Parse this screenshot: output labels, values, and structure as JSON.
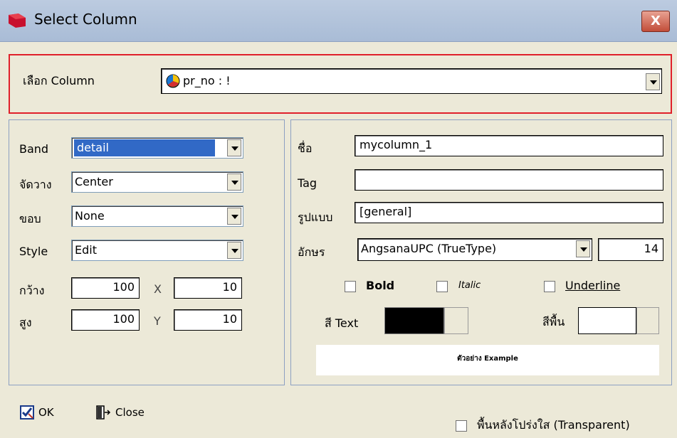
{
  "window": {
    "title": "Select Column",
    "close_label": "X"
  },
  "select_column": {
    "label": "เลือก Column",
    "value": "pr_no : !"
  },
  "left": {
    "band_label": "Band",
    "band_value": "detail",
    "align_label": "จัดวาง",
    "align_value": "Center",
    "border_label": "ขอบ",
    "border_value": "None",
    "style_label": "Style",
    "style_value": "Edit",
    "width_label": "กว้าง",
    "width_value": "100",
    "x_label": "X",
    "x_value": "10",
    "height_label": "สูง",
    "height_value": "100",
    "y_label": "Y",
    "y_value": "10"
  },
  "right": {
    "name_label": "ชื่อ",
    "name_value": "mycolumn_1",
    "tag_label": "Tag",
    "tag_value": "",
    "format_label": "รูปแบบ",
    "format_value": "[general]",
    "font_label": "อักษร",
    "font_value": "AngsanaUPC (TrueType)",
    "font_size": "14",
    "bold_label": "Bold",
    "italic_label": "Italic",
    "underline_label": "Underline",
    "text_color_label": "สี Text",
    "bg_color_label": "สีพื้น",
    "preview_text": "ตัวอย่าง Example"
  },
  "footer": {
    "ok_label": "OK",
    "close_label": "Close",
    "transparent_label": "พื้นหลังโปร่งใส (Transparent)"
  },
  "colors": {
    "text_color": "#000000",
    "bg_color": "#ffffff",
    "highlight": "#3169c6"
  }
}
